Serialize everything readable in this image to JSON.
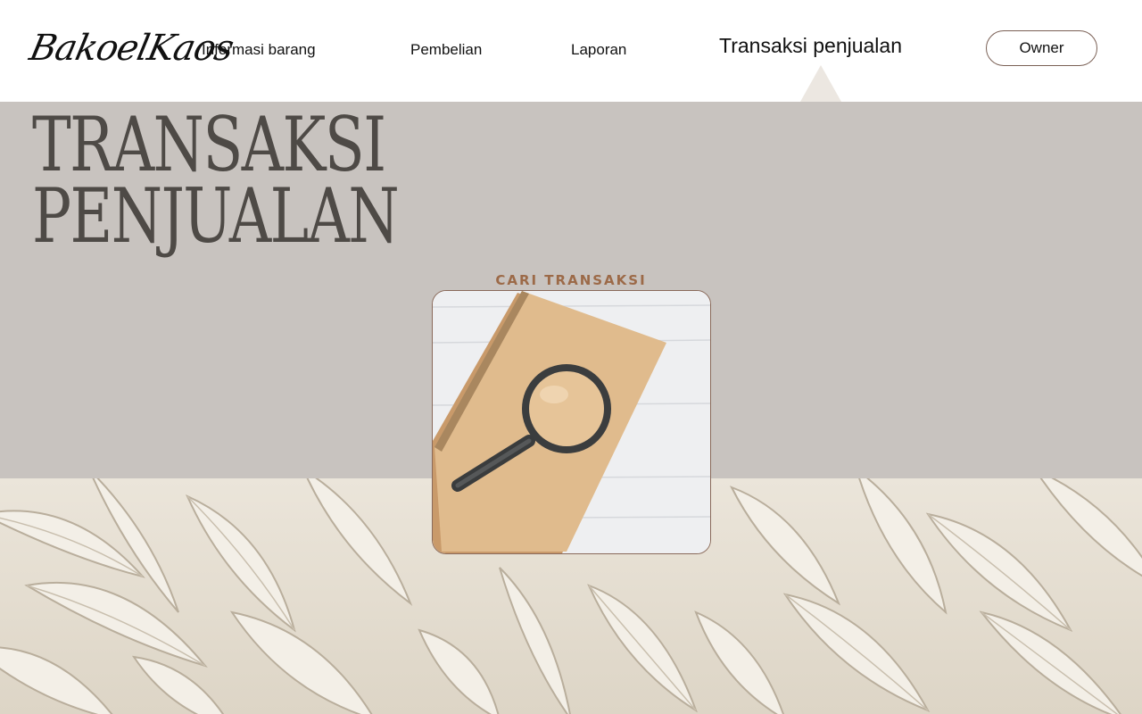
{
  "brand": {
    "logo_text": "BakoelKaos"
  },
  "nav": {
    "items": [
      {
        "label": "Informasi barang"
      },
      {
        "label": "Pembelian"
      },
      {
        "label": "Laporan"
      },
      {
        "label": "Transaksi penjualan",
        "active": true
      }
    ],
    "owner_label": "Owner"
  },
  "page": {
    "title_line1": "TRANSAKSI",
    "title_line2": "PENJUALAN"
  },
  "search": {
    "label": "CARI TRANSAKSI",
    "image_icon": "magnifying-glass-icon"
  },
  "colors": {
    "background": "#c8c3bf",
    "header": "#ffffff",
    "title": "#4e4a46",
    "accent": "#9c6a48",
    "button_border": "#7a6055"
  }
}
